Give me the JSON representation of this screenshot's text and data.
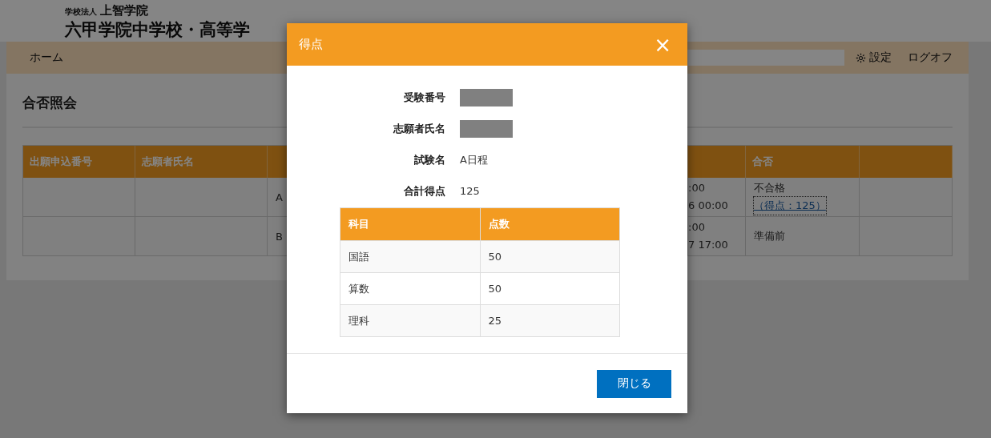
{
  "header": {
    "org": "学校法人",
    "org_name": "上智学院",
    "school": "六甲学院中学校・高等学"
  },
  "nav": {
    "home": "ホーム",
    "settings": "設定",
    "logoff": "ログオフ"
  },
  "page_title": "合否照会",
  "table": {
    "columns": [
      "出願申込番号",
      "志願者氏名"
    ],
    "result_column": "合否",
    "rows": [
      {
        "column_3": "A",
        "date_lines": [
          ":00",
          "6 00:00"
        ],
        "result": "不合格",
        "score_link": "（得点：125）"
      },
      {
        "column_3": "B",
        "date_lines": [
          ":00",
          "7 17:00"
        ],
        "result": "準備前"
      }
    ]
  },
  "dialog": {
    "title": "得点",
    "close": "×",
    "fields": [
      {
        "label": "受験番号",
        "redacted": true
      },
      {
        "label": "志願者氏名",
        "redacted": true
      },
      {
        "label": "試験名",
        "value": "A日程",
        "redacted": false
      },
      {
        "label": "合計得点",
        "value": "125",
        "redacted": false
      }
    ],
    "score_table": {
      "columns": [
        "科目",
        "点数"
      ],
      "rows": [
        [
          "国語",
          "50"
        ],
        [
          "算数",
          "50"
        ],
        [
          "理科",
          "25"
        ]
      ]
    },
    "button": "閉じる"
  }
}
